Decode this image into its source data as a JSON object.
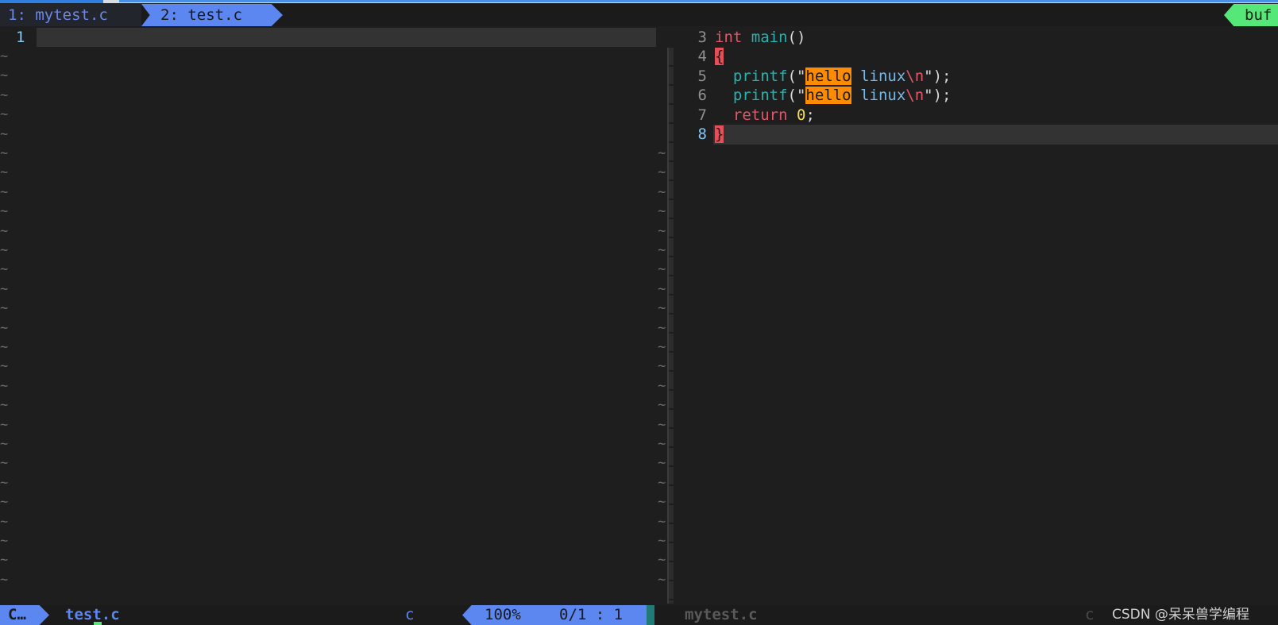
{
  "tabline": {
    "tab1_label": "1: mytest.c",
    "tab2_label": "2: test.c",
    "right_tag": "buf"
  },
  "left_window": {
    "line_number": "1",
    "filler": "~"
  },
  "right_window": {
    "lines": [
      {
        "num": "3",
        "parts": [
          {
            "t": "int",
            "c": "kw-type"
          },
          {
            "t": " ",
            "c": ""
          },
          {
            "t": "main",
            "c": "fn"
          },
          {
            "t": "()",
            "c": "punct"
          }
        ]
      },
      {
        "num": "4",
        "parts": [
          {
            "t": "{",
            "c": "brace-hl"
          }
        ]
      },
      {
        "num": "5",
        "parts": [
          {
            "t": "  ",
            "c": ""
          },
          {
            "t": "printf",
            "c": "fn"
          },
          {
            "t": "(\"",
            "c": "punct"
          },
          {
            "t": "hello",
            "c": "hl"
          },
          {
            "t": " linux",
            "c": "str"
          },
          {
            "t": "\\n",
            "c": "esc"
          },
          {
            "t": "\");",
            "c": "punct"
          }
        ]
      },
      {
        "num": "6",
        "parts": [
          {
            "t": "  ",
            "c": ""
          },
          {
            "t": "printf",
            "c": "fn"
          },
          {
            "t": "(\"",
            "c": "punct"
          },
          {
            "t": "hello",
            "c": "hl"
          },
          {
            "t": " linux",
            "c": "str"
          },
          {
            "t": "\\n",
            "c": "esc"
          },
          {
            "t": "\");",
            "c": "punct"
          }
        ]
      },
      {
        "num": "7",
        "parts": [
          {
            "t": "  ",
            "c": ""
          },
          {
            "t": "return",
            "c": "kw"
          },
          {
            "t": " ",
            "c": ""
          },
          {
            "t": "0",
            "c": "num"
          },
          {
            "t": ";",
            "c": "punct"
          }
        ]
      },
      {
        "num": "8",
        "parts": [
          {
            "t": "}",
            "c": "brace-hl"
          }
        ],
        "current": true
      }
    ],
    "filler": "~"
  },
  "statusline": {
    "mode": "C…",
    "filename": "test.c",
    "filetype": "c",
    "percent": "100%",
    "position": "0/1 :  1",
    "inactive_filename": "mytest.c",
    "inactive_filetype": "c"
  },
  "watermark": "CSDN @呆呆兽学编程"
}
